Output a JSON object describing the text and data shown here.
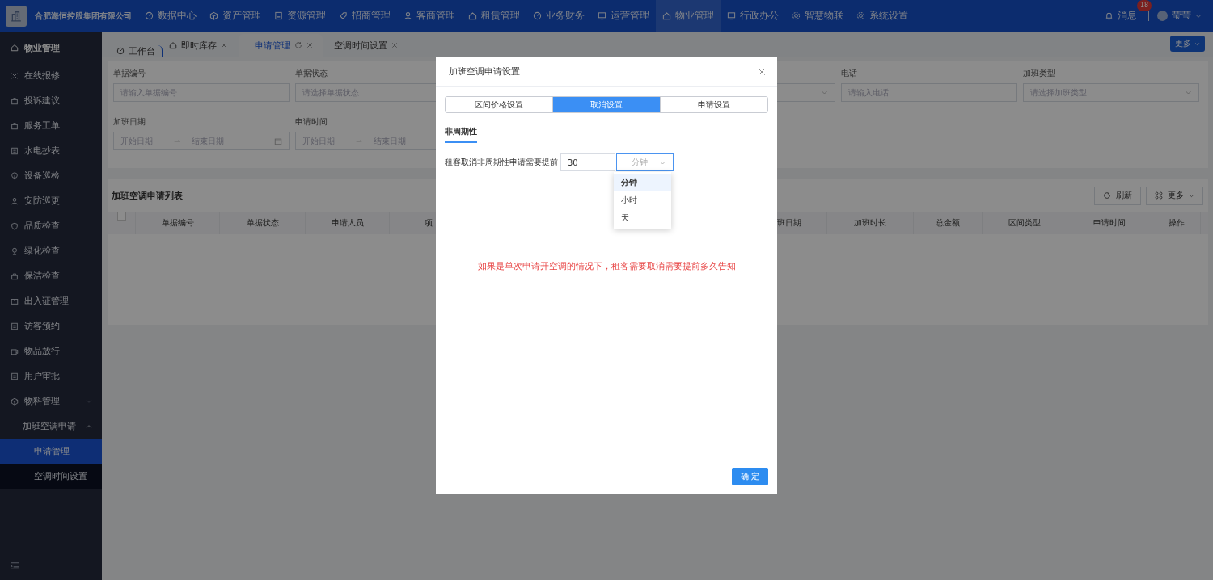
{
  "top_bar": {
    "company": "合肥海恒控股集团有限公司",
    "nav": [
      {
        "label": "数据中心",
        "selected": false
      },
      {
        "label": "资产管理",
        "selected": false
      },
      {
        "label": "资源管理",
        "selected": false
      },
      {
        "label": "招商管理",
        "selected": false
      },
      {
        "label": "客商管理",
        "selected": false
      },
      {
        "label": "租赁管理",
        "selected": false
      },
      {
        "label": "业务财务",
        "selected": false
      },
      {
        "label": "运营管理",
        "selected": false
      },
      {
        "label": "物业管理",
        "selected": true
      },
      {
        "label": "行政办公",
        "selected": false
      },
      {
        "label": "智慧物联",
        "selected": false
      },
      {
        "label": "系统设置",
        "selected": false
      }
    ],
    "messages": {
      "label": "消息",
      "badge": "18"
    },
    "user": "莹莹"
  },
  "sidebar": {
    "title": "物业管理",
    "items": [
      {
        "label": "在线报修",
        "selected": false
      },
      {
        "label": "投诉建议",
        "selected": false
      },
      {
        "label": "服务工单",
        "selected": false
      },
      {
        "label": "水电抄表",
        "selected": false
      },
      {
        "label": "设备巡检",
        "selected": false
      },
      {
        "label": "安防巡更",
        "selected": false
      },
      {
        "label": "品质检查",
        "selected": false
      },
      {
        "label": "绿化检查",
        "selected": false
      },
      {
        "label": "保洁检查",
        "selected": false
      },
      {
        "label": "出入证管理",
        "selected": false
      },
      {
        "label": "访客预约",
        "selected": false
      },
      {
        "label": "物品放行",
        "selected": false
      },
      {
        "label": "用户审批",
        "selected": false
      },
      {
        "label": "物料管理",
        "selected": false,
        "expanded": false
      },
      {
        "label": "加班空调申请",
        "selected": false,
        "expanded": true,
        "children": [
          {
            "label": "申请管理",
            "selected": true
          },
          {
            "label": "空调时间设置",
            "selected": false
          }
        ]
      }
    ]
  },
  "tabs": [
    {
      "label": "工作台",
      "selected": false,
      "closable": false
    },
    {
      "label": "即时库存",
      "selected": false,
      "closable": true
    },
    {
      "label": "申请管理",
      "selected": true,
      "closable": true
    },
    {
      "label": "空调时间设置",
      "selected": false,
      "closable": true
    }
  ],
  "more_button": "更多",
  "filters": [
    {
      "kind": "input",
      "label": "单据编号",
      "placeholder": "请输入单据编号"
    },
    {
      "kind": "select",
      "label": "单据状态",
      "placeholder": "请选择单据状态"
    },
    {
      "kind": "hidden"
    },
    {
      "kind": "select"
    },
    {
      "kind": "input",
      "label": "电话",
      "placeholder": "请输入电话"
    },
    {
      "kind": "select",
      "label": "加班类型",
      "placeholder": "请选择加班类型"
    },
    {
      "kind": "daterange",
      "label": "加班日期",
      "start": "开始日期",
      "end": "结束日期"
    },
    {
      "kind": "daterange",
      "label": "申请时间",
      "start": "开始日期",
      "end": "结束日期"
    }
  ],
  "table": {
    "title": "加班空调申请列表",
    "select_all_checked": false,
    "refresh_button": "刷新",
    "more_button": "更多",
    "columns": [
      "单据编号",
      "单据状态",
      "申请人员",
      "项",
      "班日期",
      "加班时长",
      "总金额",
      "区间类型",
      "申请时间",
      "操作"
    ]
  },
  "dialog": {
    "title": "加班空调申请设置",
    "tabs": [
      {
        "label": "区间价格设置",
        "selected": false
      },
      {
        "label": "取消设置",
        "selected": true
      },
      {
        "label": "申请设置",
        "selected": false
      }
    ],
    "section": "非周期性",
    "field_label": "租客取消非周期性申请需要提前",
    "value": "30",
    "unit": {
      "value": "分钟",
      "options": [
        {
          "label": "分钟",
          "selected": true
        },
        {
          "label": "小时",
          "selected": false
        },
        {
          "label": "天",
          "selected": false
        }
      ]
    },
    "note": "如果是单次申请开空调的情况下，租客需要取消需要提前多久告知",
    "confirm_button": "确 定"
  }
}
